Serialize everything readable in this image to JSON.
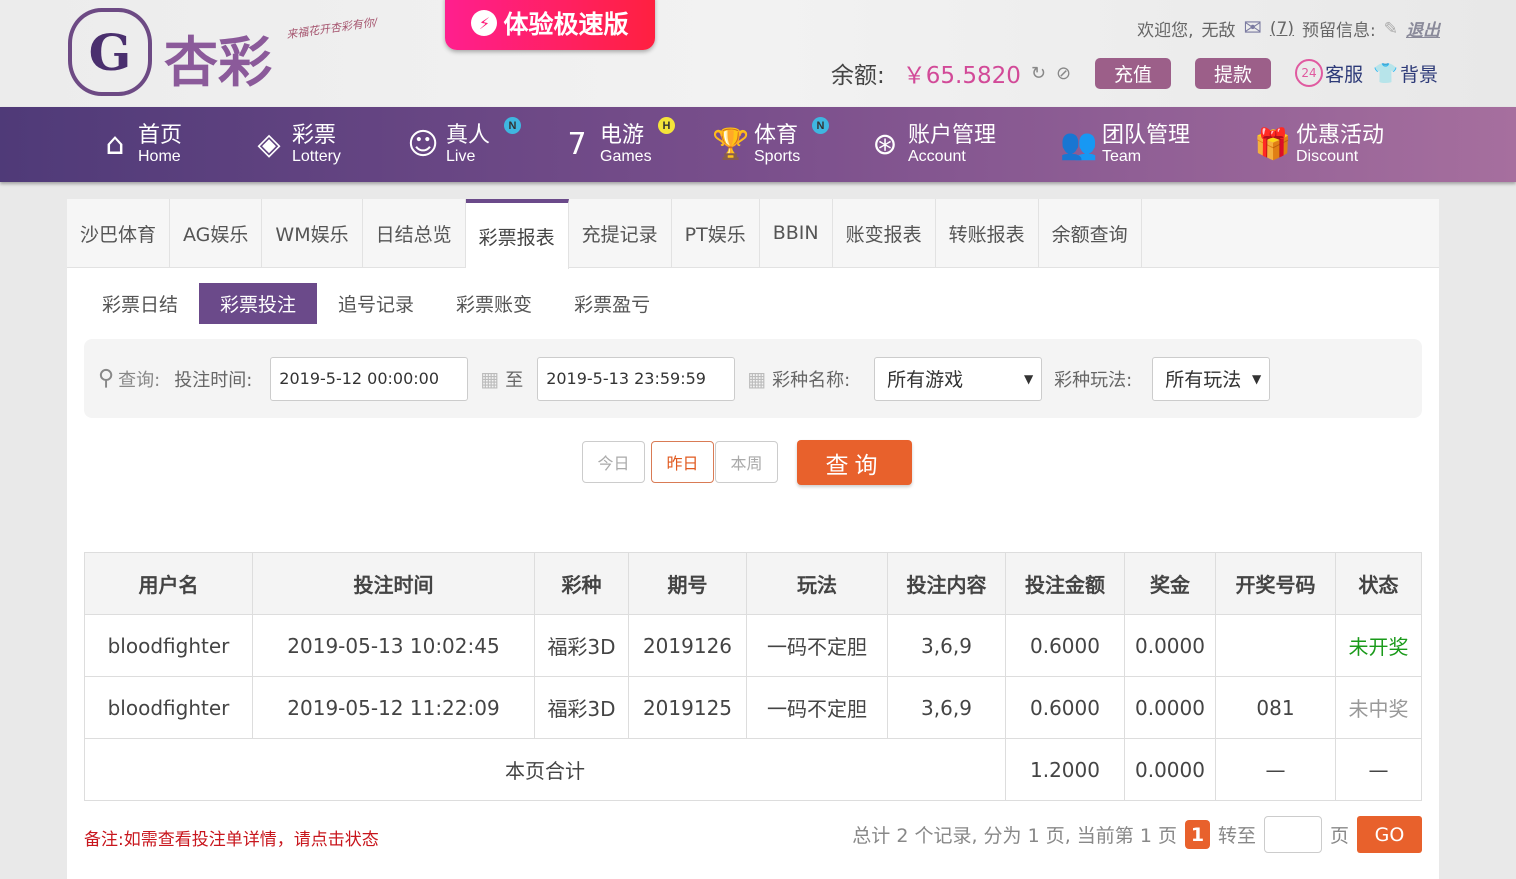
{
  "header": {
    "logo_text": "杏彩",
    "slogan": "来福花开杏彩有你/",
    "speed_label": "体验极速版",
    "welcome": "欢迎您,",
    "username": "无敌",
    "mail_count": "(7)",
    "reserved_info": "预留信息:",
    "logout": "退出",
    "balance_label": "余额:",
    "balance": "￥65.5820",
    "deposit": "充值",
    "withdraw": "提款",
    "service": "客服",
    "background": "背景"
  },
  "nav": [
    {
      "cn": "首页",
      "en": "Home",
      "icon": "⌂"
    },
    {
      "cn": "彩票",
      "en": "Lottery",
      "icon": "◈"
    },
    {
      "cn": "真人",
      "en": "Live",
      "icon": "☺",
      "badge": "N"
    },
    {
      "cn": "电游",
      "en": "Games",
      "icon": "7",
      "badge": "H"
    },
    {
      "cn": "体育",
      "en": "Sports",
      "icon": "🏆",
      "badge": "N"
    },
    {
      "cn": "账户管理",
      "en": "Account",
      "icon": "⊛"
    },
    {
      "cn": "团队管理",
      "en": "Team",
      "icon": "👥"
    },
    {
      "cn": "优惠活动",
      "en": "Discount",
      "icon": "🎁"
    }
  ],
  "tabs": [
    "沙巴体育",
    "AG娱乐",
    "WM娱乐",
    "日结总览",
    "彩票报表",
    "充提记录",
    "PT娱乐",
    "BBIN",
    "账变报表",
    "转账报表",
    "余额查询"
  ],
  "subtabs": [
    "彩票日结",
    "彩票投注",
    "追号记录",
    "彩票账变",
    "彩票盈亏"
  ],
  "search": {
    "query_label": "查询:",
    "time_label": "投注时间:",
    "start": "2019-5-12 00:00:00",
    "to": "至",
    "end": "2019-5-13 23:59:59",
    "game_label": "彩种名称:",
    "game": "所有游戏",
    "play_label": "彩种玩法:",
    "play": "所有玩法",
    "today": "今日",
    "yesterday": "昨日",
    "week": "本周",
    "submit": "查询"
  },
  "table": {
    "headers": [
      "用户名",
      "投注时间",
      "彩种",
      "期号",
      "玩法",
      "投注内容",
      "投注金额",
      "奖金",
      "开奖号码",
      "状态"
    ],
    "rows": [
      [
        "bloodfighter",
        "2019-05-13 10:02:45",
        "福彩3D",
        "2019126",
        "一码不定胆",
        "3,6,9",
        "0.6000",
        "0.0000",
        "",
        "未开奖"
      ],
      [
        "bloodfighter",
        "2019-05-12 11:22:09",
        "福彩3D",
        "2019125",
        "一码不定胆",
        "3,6,9",
        "0.6000",
        "0.0000",
        "081",
        "未中奖"
      ]
    ],
    "total": {
      "label": "本页合计",
      "amount": "1.2000",
      "bonus": "0.0000",
      "draw": "—",
      "status": "—"
    }
  },
  "footer": {
    "note": "备注:如需查看投注单详情，请点击状态",
    "summary": "总计 2 个记录, 分为 1 页, 当前第 1 页",
    "page": "1",
    "goto": "转至",
    "page_unit": "页",
    "go": "GO"
  }
}
